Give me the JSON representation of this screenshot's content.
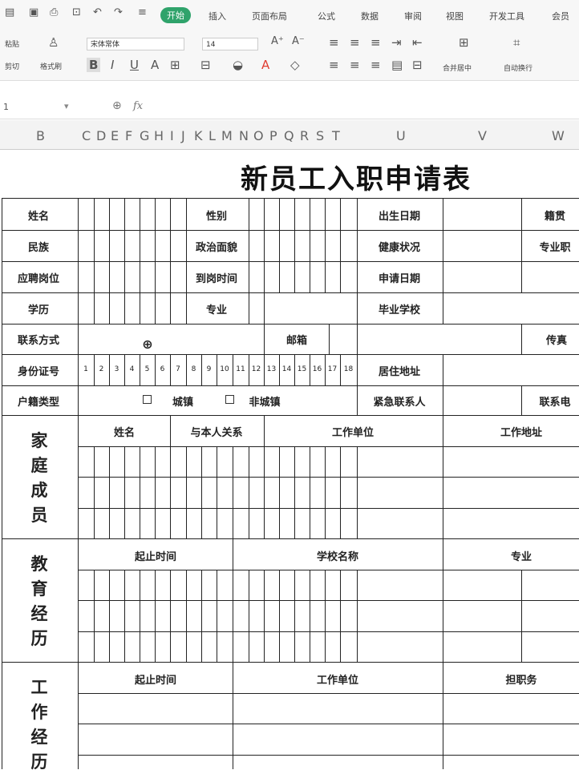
{
  "ribbon": {
    "tabs": [
      "开始",
      "插入",
      "页面布局",
      "公式",
      "数据",
      "审阅",
      "视图",
      "开发工具",
      "会员"
    ],
    "active_tab": "开始",
    "paste": "粘贴",
    "cut": "剪切",
    "format_painter": "格式刷",
    "font_name": "宋体常体",
    "font_size": "14",
    "merge_center": "合并居中",
    "wrap_text": "自动换行",
    "font_color": "#e03c31",
    "highlight_color": "#f5c400"
  },
  "formula_bar": {
    "name_box": "1",
    "fx": "fx"
  },
  "columns": [
    "B",
    "C",
    "D",
    "E",
    "F",
    "G",
    "H",
    "I",
    "J",
    "K",
    "L",
    "M",
    "N",
    "O",
    "P",
    "Q",
    "R",
    "S",
    "T",
    "U",
    "V",
    "W"
  ],
  "sheet": {
    "title": "新员工入职申请表",
    "basic": {
      "name": "姓名",
      "gender": "性别",
      "birth_date": "出生日期",
      "native_place": "籍贯",
      "ethnicity": "民族",
      "political_status": "政治面貌",
      "health": "健康状况",
      "professional_title": "专业职",
      "position": "应聘岗位",
      "arrival_time": "到岗时间",
      "apply_date": "申请日期",
      "education": "学历",
      "major": "专业",
      "school": "毕业学校",
      "contact": "联系方式",
      "email": "邮箱",
      "fax": "传真",
      "id_number": "身份证号",
      "id_digits": [
        "1",
        "2",
        "3",
        "4",
        "5",
        "6",
        "7",
        "8",
        "9",
        "10",
        "11",
        "12",
        "13",
        "14",
        "15",
        "16",
        "17",
        "18"
      ],
      "address": "居住地址",
      "hukou": "户籍类型",
      "urban": "城镇",
      "rural": "非城镇",
      "emergency": "紧急联系人",
      "contact_phone": "联系电"
    },
    "family": {
      "label": [
        "家",
        "庭",
        "成",
        "员"
      ],
      "headers": [
        "姓名",
        "与本人关系",
        "工作单位",
        "工作地址"
      ]
    },
    "edu": {
      "label": [
        "教",
        "育",
        "经",
        "历"
      ],
      "headers": [
        "起止时间",
        "学校名称",
        "专业"
      ]
    },
    "work": {
      "label": [
        "工",
        "作",
        "经",
        "历"
      ],
      "headers": [
        "起止时间",
        "工作单位",
        "担职务"
      ]
    }
  }
}
